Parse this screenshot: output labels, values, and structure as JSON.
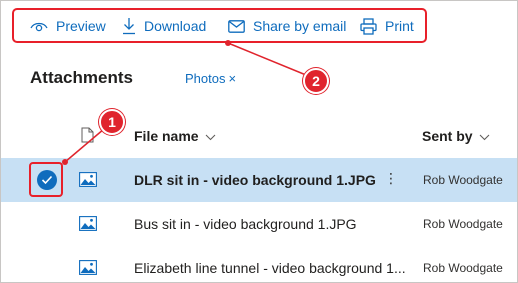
{
  "toolbar": {
    "preview": {
      "label": "Preview",
      "icon": "eye-icon"
    },
    "download": {
      "label": "Download",
      "icon": "download-icon"
    },
    "share": {
      "label": "Share by email",
      "icon": "mail-icon"
    },
    "print": {
      "label": "Print",
      "icon": "printer-icon"
    }
  },
  "attachments": {
    "title": "Attachments",
    "filter_label": "Photos",
    "filter_clear": "×"
  },
  "columns": {
    "file_name": "File name",
    "sent_by": "Sent by"
  },
  "rows": [
    {
      "file_name": "DLR sit in - video background 1.JPG",
      "sent_by": "Rob Woodgate",
      "selected": true,
      "more": "⋮"
    },
    {
      "file_name": "Bus sit in - video background 1.JPG",
      "sent_by": "Rob Woodgate",
      "selected": false
    },
    {
      "file_name": "Elizabeth line tunnel - video background 1...",
      "sent_by": "Rob Woodgate",
      "selected": false
    }
  ],
  "callouts": {
    "one": "1",
    "two": "2"
  },
  "colors": {
    "accent": "#0f6cbd",
    "selection": "#c7e0f4",
    "callout": "#e0242d"
  }
}
